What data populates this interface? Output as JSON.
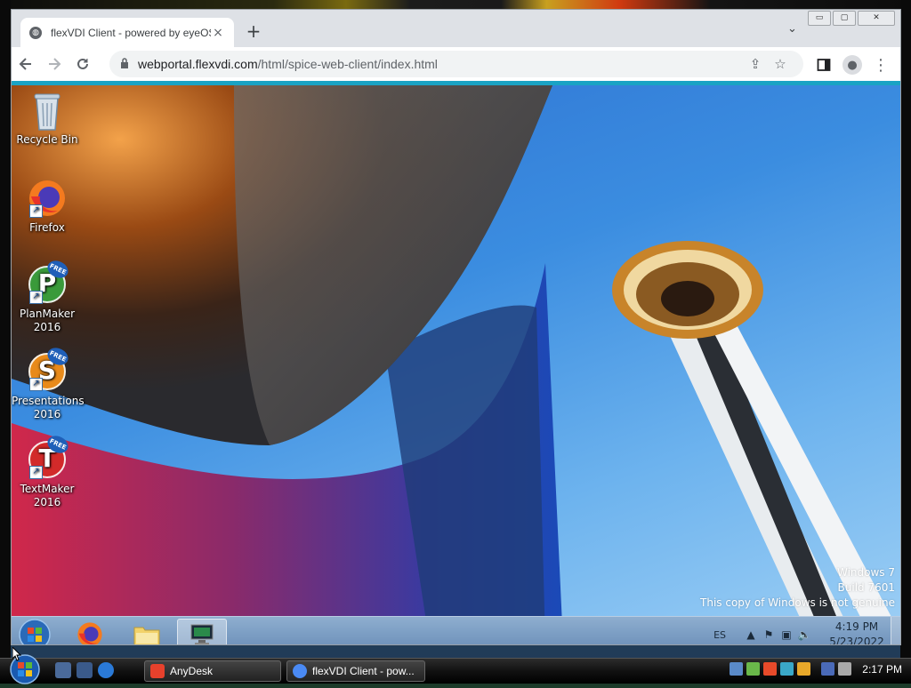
{
  "browser": {
    "tab_title": "flexVDI Client - powered by eyeOS",
    "url_host": "webportal.flexvdi.com",
    "url_path": "/html/spice-web-client/index.html",
    "new_tab": "+",
    "tab_close": "×",
    "window_controls": [
      "▭",
      "▢",
      "✕"
    ]
  },
  "remote_desktop": {
    "icons": [
      {
        "label": "Recycle Bin",
        "icon": "recycle-bin-icon"
      },
      {
        "label": "Firefox",
        "icon": "firefox-icon"
      },
      {
        "label": "PlanMaker 2016",
        "icon": "planmaker-icon",
        "letter": "P",
        "badge": "FREE"
      },
      {
        "label": "Presentations 2016",
        "icon": "presentations-icon",
        "letter": "S",
        "badge": "FREE"
      },
      {
        "label": "TextMaker 2016",
        "icon": "textmaker-icon",
        "letter": "T",
        "badge": "FREE"
      }
    ],
    "watermark": {
      "line1": "Windows 7",
      "line2": "Build 7601",
      "line3": "This copy of Windows is not genuine"
    },
    "taskbar": {
      "language": "ES",
      "time": "4:19 PM",
      "date": "5/23/2022"
    }
  },
  "host_taskbar": {
    "buttons": [
      {
        "label": "AnyDesk",
        "color": "#e8412c"
      },
      {
        "label": "flexVDI Client - pow...",
        "color": "#4a8af4"
      }
    ],
    "time": "2:17 PM"
  },
  "colors": {
    "accent": "#1aa3c4",
    "remote_taskbar": "#7b9dc3",
    "planmaker": "#3a9a3a",
    "presentations": "#e88a1a",
    "textmaker": "#d22a2a"
  }
}
